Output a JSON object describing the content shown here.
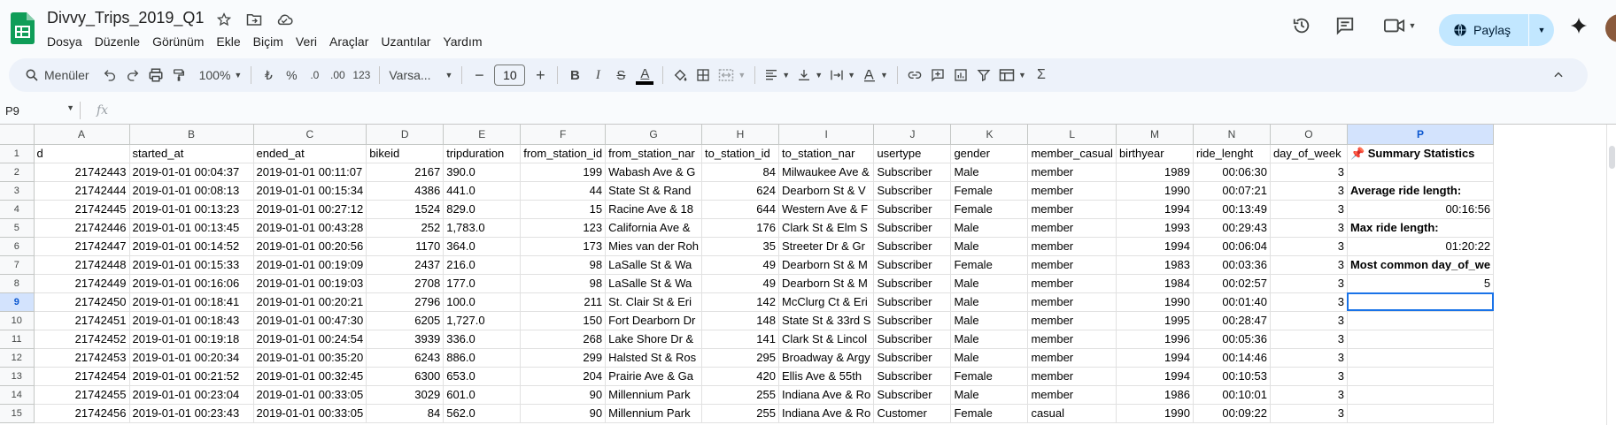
{
  "app": {
    "doc_title": "Divvy_Trips_2019_Q1",
    "menu": [
      "Dosya",
      "Düzenle",
      "Görünüm",
      "Ekle",
      "Biçim",
      "Veri",
      "Araçlar",
      "Uzantılar",
      "Yardım"
    ],
    "title_icons": [
      "star-icon",
      "move-to-folder-icon",
      "cloud-status-icon"
    ],
    "right_icons": [
      "version-history-icon",
      "comments-icon",
      "meet-video-icon",
      "gemini-spark-icon"
    ],
    "share_label": "Paylaş",
    "colors": {
      "accent": "#1a73e8",
      "share_bg": "#c2e7ff",
      "toolbar_bg": "#edf2fa",
      "selected_header": "#d3e3fd",
      "sheets_green": "#0f9d58"
    }
  },
  "toolbar": {
    "menus_label": "Menüler",
    "zoom": "100%",
    "currency": "₺",
    "percent": "%",
    "dec_decrease": ".0",
    "dec_increase": ".00",
    "more_formats": "123",
    "font_name": "Varsa...",
    "font_size": "10",
    "minus": "−",
    "plus": "+",
    "bold": "B",
    "italic": "I",
    "strike": "S",
    "text_color": "A",
    "sigma": "Σ"
  },
  "formula_bar": {
    "cell_ref": "P9",
    "fx": "fx",
    "content": ""
  },
  "sheet": {
    "columns": [
      "A",
      "B",
      "C",
      "D",
      "E",
      "F",
      "G",
      "H",
      "I",
      "J",
      "K",
      "L",
      "M",
      "N",
      "O",
      "P"
    ],
    "selected_column": "P",
    "selected_row": "9",
    "rows": [
      {
        "n": "1",
        "cells": [
          "d",
          "started_at",
          "ended_at",
          "bikeid",
          "tripduration",
          "from_station_id",
          "from_station_nar",
          "to_station_id",
          "to_station_nar",
          "usertype",
          "gender",
          "member_casual",
          "birthyear",
          "ride_lenght",
          "day_of_week",
          "📌 Summary Statistics"
        ]
      },
      {
        "n": "2",
        "cells": [
          "21742443",
          "2019-01-01 00:04:37",
          "2019-01-01 00:11:07",
          "2167",
          "390.0",
          "199",
          "Wabash Ave & G",
          "84",
          "Milwaukee Ave &",
          "Subscriber",
          "Male",
          "member",
          "1989",
          "00:06:30",
          "3",
          ""
        ]
      },
      {
        "n": "3",
        "cells": [
          "21742444",
          "2019-01-01 00:08:13",
          "2019-01-01 00:15:34",
          "4386",
          "441.0",
          "44",
          "State St & Rand",
          "624",
          "Dearborn St & V",
          "Subscriber",
          "Female",
          "member",
          "1990",
          "00:07:21",
          "3",
          "Average ride length:"
        ]
      },
      {
        "n": "4",
        "cells": [
          "21742445",
          "2019-01-01 00:13:23",
          "2019-01-01 00:27:12",
          "1524",
          "829.0",
          "15",
          "Racine Ave & 18",
          "644",
          "Western Ave & F",
          "Subscriber",
          "Female",
          "member",
          "1994",
          "00:13:49",
          "3",
          "00:16:56"
        ]
      },
      {
        "n": "5",
        "cells": [
          "21742446",
          "2019-01-01 00:13:45",
          "2019-01-01 00:43:28",
          "252",
          "1,783.0",
          "123",
          "California Ave &",
          "176",
          "Clark St & Elm S",
          "Subscriber",
          "Male",
          "member",
          "1993",
          "00:29:43",
          "3",
          "Max ride length:"
        ]
      },
      {
        "n": "6",
        "cells": [
          "21742447",
          "2019-01-01 00:14:52",
          "2019-01-01 00:20:56",
          "1170",
          "364.0",
          "173",
          "Mies van der Roh",
          "35",
          "Streeter Dr & Gr",
          "Subscriber",
          "Male",
          "member",
          "1994",
          "00:06:04",
          "3",
          "01:20:22"
        ]
      },
      {
        "n": "7",
        "cells": [
          "21742448",
          "2019-01-01 00:15:33",
          "2019-01-01 00:19:09",
          "2437",
          "216.0",
          "98",
          "LaSalle St & Wa",
          "49",
          "Dearborn St & M",
          "Subscriber",
          "Female",
          "member",
          "1983",
          "00:03:36",
          "3",
          "Most common day_of_we"
        ]
      },
      {
        "n": "8",
        "cells": [
          "21742449",
          "2019-01-01 00:16:06",
          "2019-01-01 00:19:03",
          "2708",
          "177.0",
          "98",
          "LaSalle St & Wa",
          "49",
          "Dearborn St & M",
          "Subscriber",
          "Male",
          "member",
          "1984",
          "00:02:57",
          "3",
          "5"
        ]
      },
      {
        "n": "9",
        "cells": [
          "21742450",
          "2019-01-01 00:18:41",
          "2019-01-01 00:20:21",
          "2796",
          "100.0",
          "211",
          "St. Clair St & Eri",
          "142",
          "McClurg Ct & Eri",
          "Subscriber",
          "Male",
          "member",
          "1990",
          "00:01:40",
          "3",
          ""
        ]
      },
      {
        "n": "10",
        "cells": [
          "21742451",
          "2019-01-01 00:18:43",
          "2019-01-01 00:47:30",
          "6205",
          "1,727.0",
          "150",
          "Fort Dearborn Dr",
          "148",
          "State St & 33rd S",
          "Subscriber",
          "Male",
          "member",
          "1995",
          "00:28:47",
          "3",
          ""
        ]
      },
      {
        "n": "11",
        "cells": [
          "21742452",
          "2019-01-01 00:19:18",
          "2019-01-01 00:24:54",
          "3939",
          "336.0",
          "268",
          "Lake Shore Dr &",
          "141",
          "Clark St & Lincol",
          "Subscriber",
          "Male",
          "member",
          "1996",
          "00:05:36",
          "3",
          ""
        ]
      },
      {
        "n": "12",
        "cells": [
          "21742453",
          "2019-01-01 00:20:34",
          "2019-01-01 00:35:20",
          "6243",
          "886.0",
          "299",
          "Halsted St & Ros",
          "295",
          "Broadway & Argy",
          "Subscriber",
          "Male",
          "member",
          "1994",
          "00:14:46",
          "3",
          ""
        ]
      },
      {
        "n": "13",
        "cells": [
          "21742454",
          "2019-01-01 00:21:52",
          "2019-01-01 00:32:45",
          "6300",
          "653.0",
          "204",
          "Prairie Ave & Ga",
          "420",
          "Ellis Ave & 55th",
          "Subscriber",
          "Female",
          "member",
          "1994",
          "00:10:53",
          "3",
          ""
        ]
      },
      {
        "n": "14",
        "cells": [
          "21742455",
          "2019-01-01 00:23:04",
          "2019-01-01 00:33:05",
          "3029",
          "601.0",
          "90",
          "Millennium Park",
          "255",
          "Indiana Ave & Ro",
          "Subscriber",
          "Male",
          "member",
          "1986",
          "00:10:01",
          "3",
          ""
        ]
      },
      {
        "n": "15",
        "cells": [
          "21742456",
          "2019-01-01 00:23:43",
          "2019-01-01 00:33:05",
          "84",
          "562.0",
          "90",
          "Millennium Park",
          "255",
          "Indiana Ave & Ro",
          "Customer",
          "Female",
          "casual",
          "1990",
          "00:09:22",
          "3",
          ""
        ]
      }
    ]
  }
}
